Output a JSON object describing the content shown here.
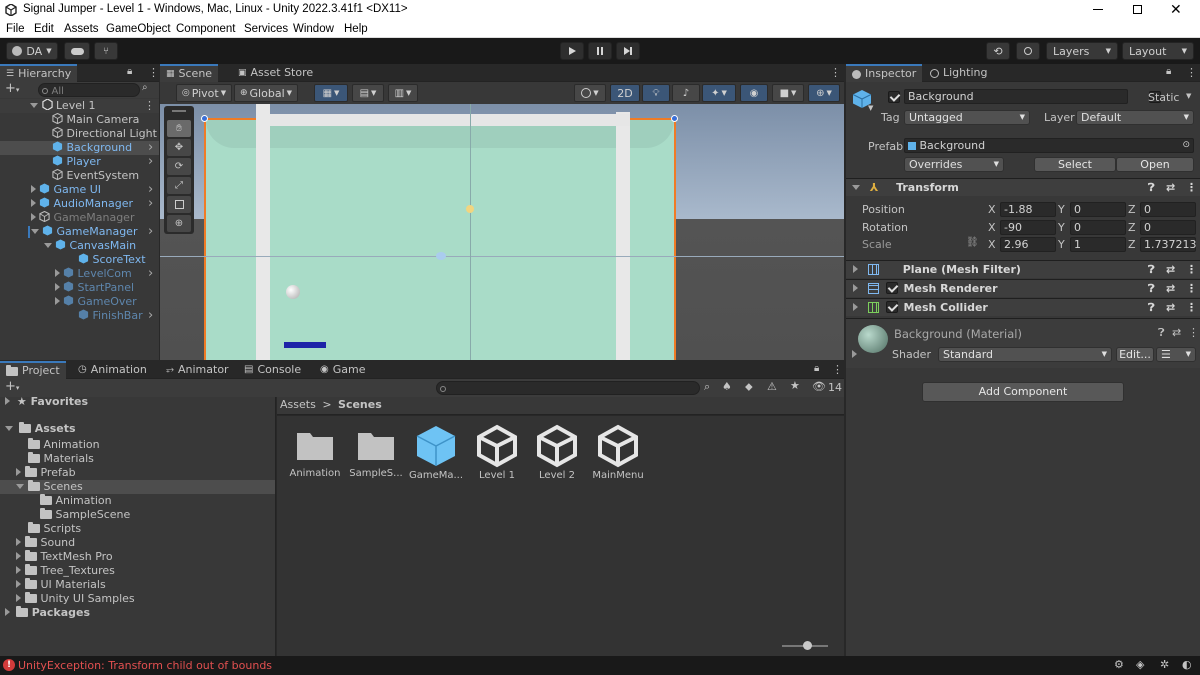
{
  "window": {
    "title": "Signal Jumper - Level 1 - Windows, Mac, Linux - Unity 2022.3.41f1 <DX11>"
  },
  "menu": [
    "File",
    "Edit",
    "Assets",
    "GameObject",
    "Component",
    "Services",
    "Window",
    "Help"
  ],
  "toolbar": {
    "account": "DA",
    "layers": "Layers",
    "layout": "Layout"
  },
  "hierarchy": {
    "tab": "Hierarchy",
    "search_placeholder": "All",
    "scene": "Level 1",
    "items": [
      "Main Camera",
      "Directional Light",
      "Background",
      "Player",
      "EventSystem",
      "Game UI",
      "AudioManager",
      "GameManager",
      "GameManager",
      "CanvasMain",
      "ScoreText",
      "LevelCom",
      "StartPanel",
      "GameOver",
      "FinishBar"
    ]
  },
  "scene_view": {
    "tabs": [
      "Scene",
      "Asset Store"
    ],
    "pivot": "Pivot",
    "global": "Global",
    "mode_2d": "2D"
  },
  "inspector": {
    "tabs": [
      "Inspector",
      "Lighting"
    ],
    "object_name": "Background",
    "static_label": "Static",
    "tag_label": "Tag",
    "tag_value": "Untagged",
    "layer_label": "Layer",
    "layer_value": "Default",
    "prefab_label": "Prefab",
    "prefab_value": "Background",
    "overrides": "Overrides",
    "select": "Select",
    "open": "Open",
    "transform": {
      "title": "Transform",
      "position_label": "Position",
      "rotation_label": "Rotation",
      "scale_label": "Scale",
      "axes": [
        "X",
        "Y",
        "Z"
      ],
      "position": [
        "-1.88",
        "0",
        "0"
      ],
      "rotation": [
        "-90",
        "0",
        "0"
      ],
      "scale": [
        "2.96",
        "1",
        "1.737213"
      ]
    },
    "components": [
      "Plane (Mesh Filter)",
      "Mesh Renderer",
      "Mesh Collider"
    ],
    "material": {
      "name": "Background (Material)",
      "shader_label": "Shader",
      "shader_value": "Standard",
      "edit": "Edit..."
    },
    "add_component": "Add Component"
  },
  "bottom_tabs": [
    "Project",
    "Animation",
    "Animator",
    "Console",
    "Game"
  ],
  "project": {
    "favorites": "Favorites",
    "assets": "Assets",
    "tree": [
      "Animation",
      "Materials",
      "Prefab",
      "Scenes",
      "Animation",
      "SampleScene",
      "Scripts",
      "Sound",
      "TextMesh Pro",
      "Tree_Textures",
      "UI Materials",
      "Unity UI Samples"
    ],
    "packages": "Packages",
    "breadcrumb": [
      "Assets",
      "Scenes"
    ],
    "count": "14",
    "files": [
      "Animation",
      "SampleS...",
      "GameMa...",
      "Level 1",
      "Level 2",
      "MainMenu"
    ]
  },
  "status": {
    "error": "UnityException: Transform child out of bounds"
  }
}
